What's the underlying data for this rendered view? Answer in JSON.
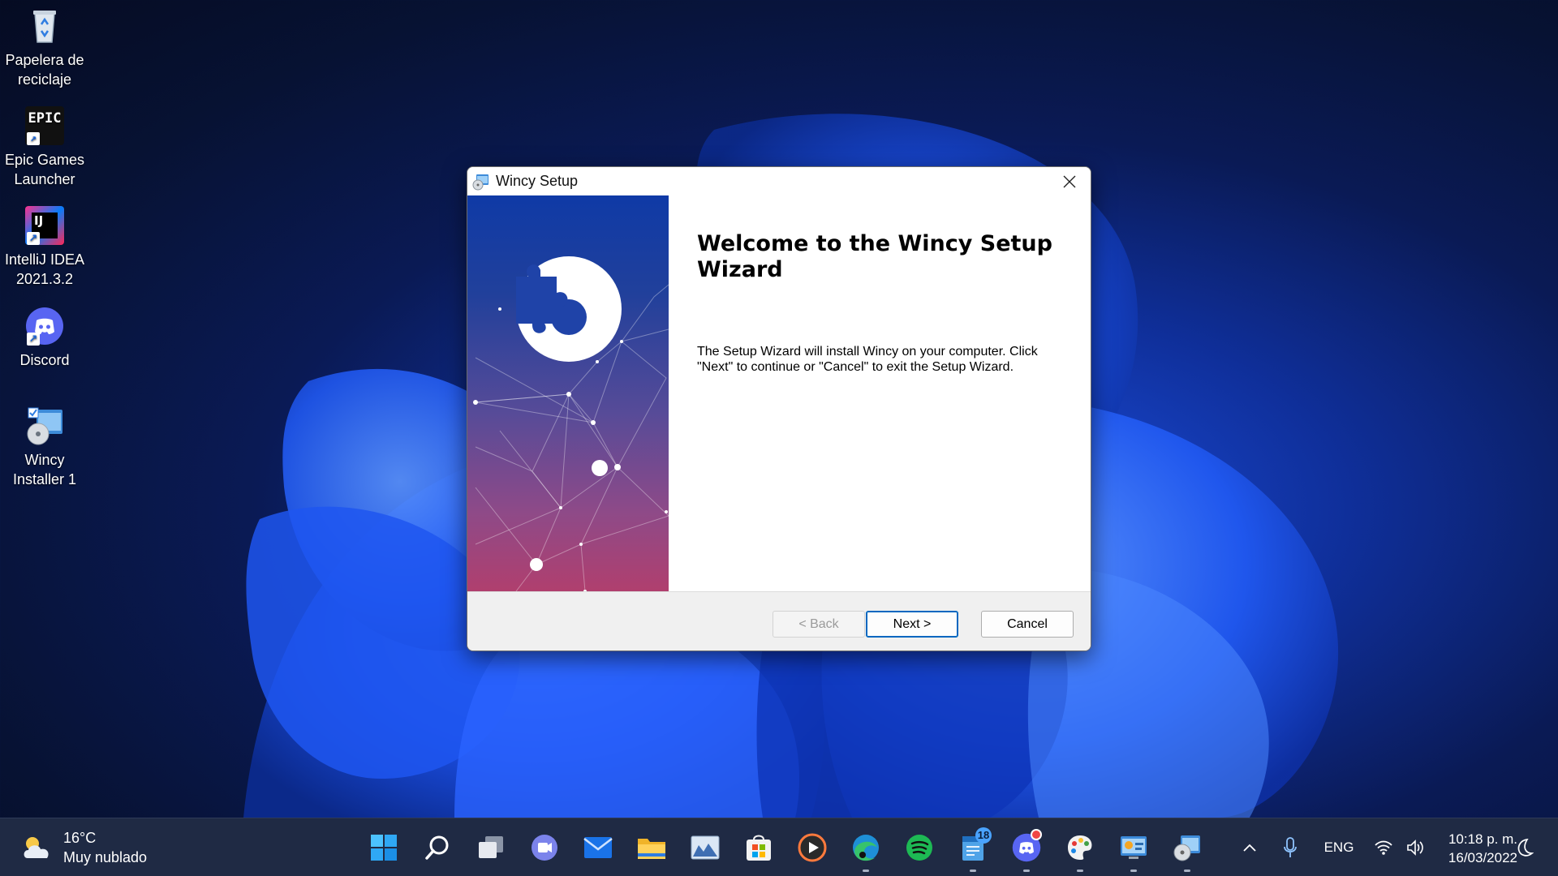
{
  "desktop": {
    "icons": [
      {
        "label_l1": "Papelera de",
        "label_l2": "reciclaje",
        "icon": "recycle-bin-icon"
      },
      {
        "label_l1": "Epic Games",
        "label_l2": "Launcher",
        "icon": "epic-games-icon",
        "logo_text": "EPIC"
      },
      {
        "label_l1": "IntelliJ IDEA",
        "label_l2": "2021.3.2",
        "icon": "intellij-icon",
        "logo_text": "IJ"
      },
      {
        "label_l1": "Discord",
        "label_l2": "",
        "icon": "discord-icon"
      },
      {
        "label_l1": "Wincy",
        "label_l2": "Installer 1",
        "icon": "installer-icon"
      }
    ]
  },
  "dialog": {
    "window_title": "Wincy Setup",
    "heading": "Welcome to the Wincy Setup Wizard",
    "body": "The Setup Wizard will install Wincy on your computer.  Click \"Next\" to continue or \"Cancel\" to exit the Setup Wizard.",
    "buttons": {
      "back": "< Back",
      "next": "Next >",
      "cancel": "Cancel"
    },
    "back_enabled": false
  },
  "taskbar": {
    "weather": {
      "temp": "16°C",
      "condition": "Muy nublado"
    },
    "apps": [
      {
        "name": "start-button",
        "icon": "windows-logo-icon"
      },
      {
        "name": "search-button",
        "icon": "search-icon"
      },
      {
        "name": "task-view-button",
        "icon": "task-view-icon"
      },
      {
        "name": "chat-button",
        "icon": "teams-chat-icon"
      },
      {
        "name": "mail-app",
        "icon": "mail-icon"
      },
      {
        "name": "file-explorer-app",
        "icon": "folder-icon"
      },
      {
        "name": "photos-app",
        "icon": "photos-icon"
      },
      {
        "name": "store-app",
        "icon": "store-icon"
      },
      {
        "name": "media-player-app",
        "icon": "media-play-icon"
      },
      {
        "name": "edge-app",
        "icon": "edge-icon"
      },
      {
        "name": "spotify-app",
        "icon": "spotify-icon"
      },
      {
        "name": "notepad-app",
        "icon": "notepad-icon",
        "badge": "18"
      },
      {
        "name": "discord-app",
        "icon": "discord-icon"
      },
      {
        "name": "paint-app",
        "icon": "paint-icon"
      },
      {
        "name": "control-panel-app",
        "icon": "control-panel-icon"
      },
      {
        "name": "installer-app",
        "icon": "installer-icon"
      }
    ],
    "tray": {
      "language": "ENG"
    },
    "clock": {
      "time": "10:18 p. m.",
      "date": "16/03/2022"
    }
  },
  "colors": {
    "accent": "#0067c0",
    "taskbar": "#1f2a44",
    "banner_top": "#0f3aa6",
    "banner_bottom": "#b03f6e"
  }
}
